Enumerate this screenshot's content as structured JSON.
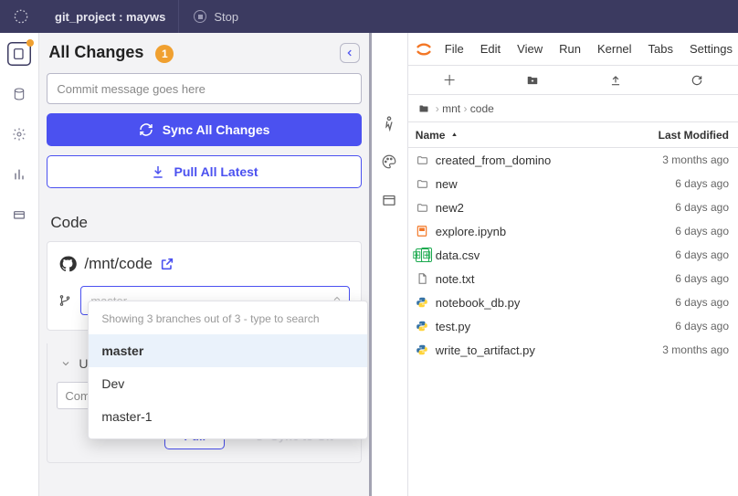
{
  "topbar": {
    "project_label": "git_project : mayws",
    "stop_label": "Stop"
  },
  "left": {
    "title": "All Changes",
    "change_count": "1",
    "commit_placeholder": "Commit message goes here",
    "sync_label": "Sync All Changes",
    "pull_label": "Pull All Latest",
    "code_section": "Code",
    "code_path": "/mnt/code",
    "branch_placeholder": "master",
    "dropdown_hint": "Showing 3 branches out of 3 - type to search",
    "branches": [
      "master",
      "Dev",
      "master-1"
    ],
    "selected_branch_index": 0,
    "uncommitted_label": "Und",
    "lower_input_value": "Comr",
    "pull_btn": "Pull",
    "sync_git_btn": "Sync to Git"
  },
  "menus": [
    "File",
    "Edit",
    "View",
    "Run",
    "Kernel",
    "Tabs",
    "Settings"
  ],
  "breadcrumbs": [
    "mnt",
    "code"
  ],
  "file_columns": {
    "name": "Name",
    "modified": "Last Modified"
  },
  "files": [
    {
      "icon": "folder",
      "name": "created_from_domino",
      "modified": "3 months ago"
    },
    {
      "icon": "folder",
      "name": "new",
      "modified": "6 days ago"
    },
    {
      "icon": "folder",
      "name": "new2",
      "modified": "6 days ago"
    },
    {
      "icon": "ipynb",
      "name": "explore.ipynb",
      "modified": "6 days ago"
    },
    {
      "icon": "csv",
      "name": "data.csv",
      "modified": "6 days ago"
    },
    {
      "icon": "txt",
      "name": "note.txt",
      "modified": "6 days ago"
    },
    {
      "icon": "py",
      "name": "notebook_db.py",
      "modified": "6 days ago"
    },
    {
      "icon": "py",
      "name": "test.py",
      "modified": "6 days ago"
    },
    {
      "icon": "py",
      "name": "write_to_artifact.py",
      "modified": "3 months ago"
    }
  ]
}
